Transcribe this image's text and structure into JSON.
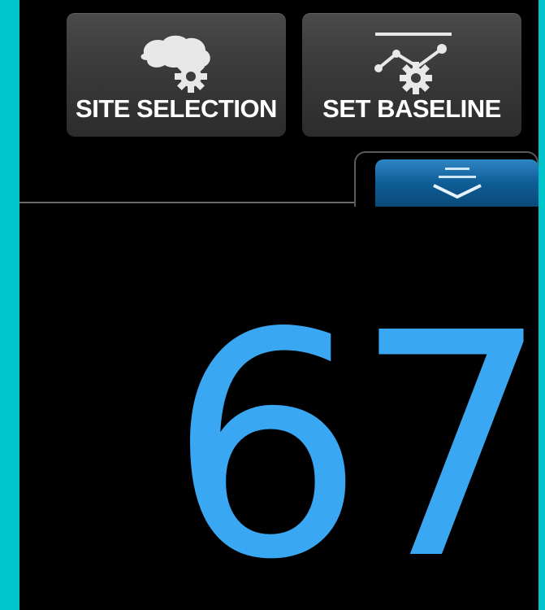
{
  "buttons": {
    "site_selection": {
      "label": "SITE SELECTION",
      "icon": "brain-gear-icon"
    },
    "set_baseline": {
      "label": "SET BASELINE",
      "icon": "trend-gear-icon"
    }
  },
  "drawer": {
    "icon": "chevron-down-icon"
  },
  "readout": {
    "value": "67",
    "color": "#3aa7f2"
  },
  "colors": {
    "bezel": "#00c6cc",
    "screen": "#000000",
    "button": "#3a3a3a",
    "drawer_handle": "#0e5d96"
  }
}
